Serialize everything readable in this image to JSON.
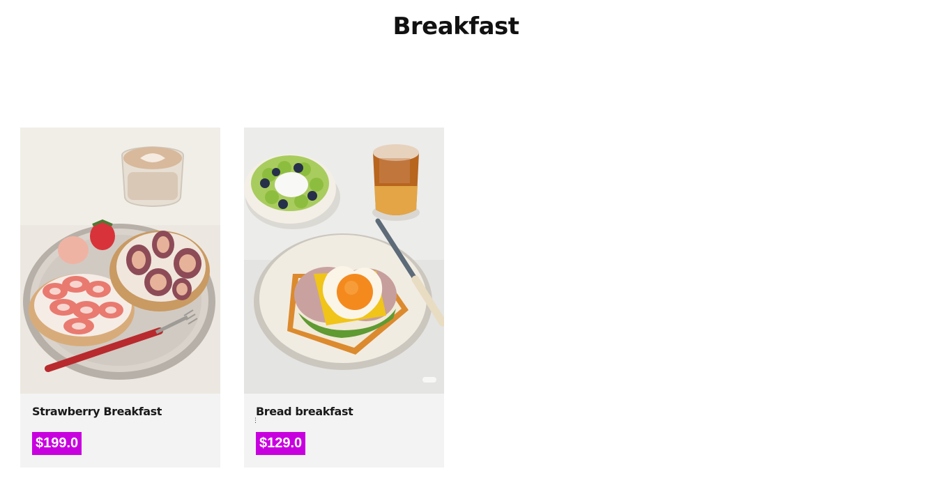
{
  "page": {
    "title": "Breakfast"
  },
  "products": [
    {
      "name": "Strawberry Breakfast",
      "price": "$199.0",
      "image": "strawberry-breakfast-plate-photo"
    },
    {
      "name": "Bread breakfast",
      "price": "$129.0",
      "image": "egg-toast-breakfast-plate-photo"
    }
  ],
  "colors": {
    "price_badge": "#c800e0",
    "card_background": "#f3f3f3",
    "page_background": "#ffffff"
  }
}
